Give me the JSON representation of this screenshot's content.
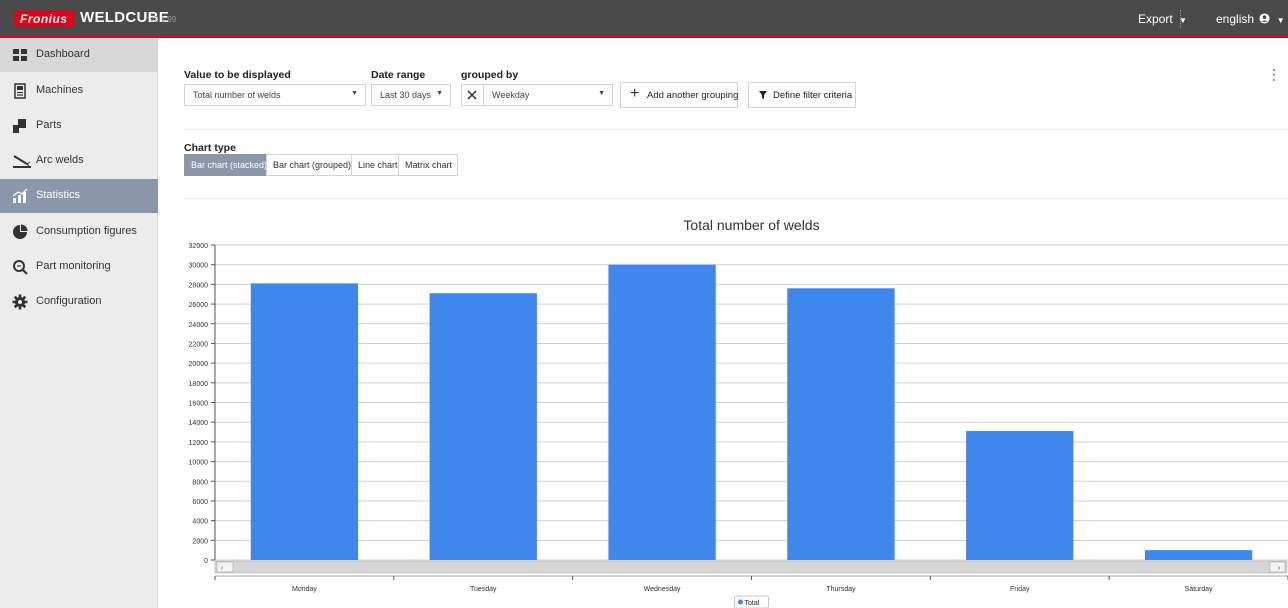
{
  "header": {
    "brand": "Fronius",
    "app_name": "WELDCUBE",
    "version": "v2.1.99",
    "export_label": "Export",
    "language_label": "english"
  },
  "sidebar": {
    "items": [
      {
        "label": "Dashboard",
        "icon": "dashboard-icon"
      },
      {
        "label": "Machines",
        "icon": "machine-icon"
      },
      {
        "label": "Parts",
        "icon": "parts-icon"
      },
      {
        "label": "Arc welds",
        "icon": "arc-weld-icon"
      },
      {
        "label": "Statistics",
        "icon": "statistics-icon",
        "active": true
      },
      {
        "label": "Consumption figures",
        "icon": "pie-chart-icon"
      },
      {
        "label": "Part monitoring",
        "icon": "search-icon"
      },
      {
        "label": "Configuration",
        "icon": "gear-icon"
      }
    ]
  },
  "filters": {
    "value_label": "Value to be displayed",
    "value_selected": "Total number of welds",
    "date_label": "Date range",
    "date_selected": "Last 30 days",
    "group_label": "grouped by",
    "group_selected": "Weekday",
    "add_grouping_label": "Add another grouping",
    "filter_label": "Define filter criteria"
  },
  "chart_type": {
    "label": "Chart type",
    "options": [
      "Bar chart (stacked)",
      "Bar chart (grouped)",
      "Line chart",
      "Matrix chart"
    ],
    "selected": "Bar chart (stacked)"
  },
  "chart_data": {
    "type": "bar",
    "title": "Total number of welds",
    "categories": [
      "Monday",
      "Tuesday",
      "Wednesday",
      "Thursday",
      "Friday",
      "Saturday"
    ],
    "series": [
      {
        "name": "Total",
        "values": [
          28100,
          27100,
          30000,
          27600,
          13100,
          1000
        ]
      }
    ],
    "ylim": [
      0,
      32000
    ],
    "yticks": [
      0,
      2000,
      4000,
      6000,
      8000,
      10000,
      12000,
      14000,
      16000,
      18000,
      20000,
      22000,
      24000,
      26000,
      28000,
      30000,
      32000
    ],
    "xlabel": "",
    "ylabel": "",
    "grid": true,
    "legend": "bottom",
    "color": "#3f87ec"
  }
}
